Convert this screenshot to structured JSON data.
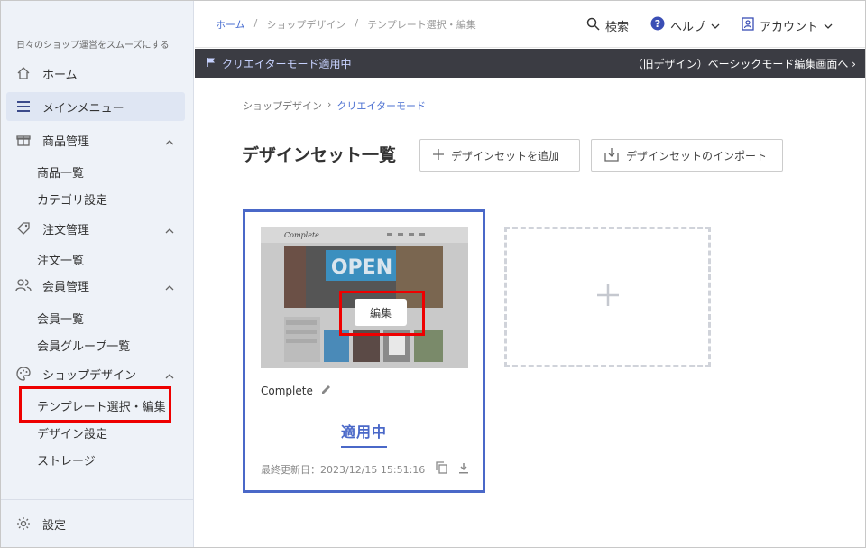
{
  "sidebar": {
    "tagline": "日々のショップ運営をスムーズにする",
    "items": [
      {
        "label": "ホーム"
      },
      {
        "label": "メインメニュー"
      },
      {
        "label": "商品管理"
      },
      {
        "label": "注文管理"
      },
      {
        "label": "会員管理"
      },
      {
        "label": "ショップデザイン"
      }
    ],
    "subs": {
      "product": [
        "商品一覧",
        "カテゴリ設定"
      ],
      "order": [
        "注文一覧"
      ],
      "member": [
        "会員一覧",
        "会員グループ一覧"
      ],
      "design": [
        "テンプレート選択・編集",
        "デザイン設定",
        "ストレージ"
      ]
    },
    "settings": "設定"
  },
  "topbar": {
    "breadcrumb": [
      "ホーム",
      "/",
      "ショップデザイン",
      "/",
      "テンプレート選択・編集"
    ],
    "search": "検索",
    "help": "ヘルプ",
    "account": "アカウント"
  },
  "banner": {
    "left": "クリエイターモード適用中",
    "right": "（旧デザイン）ベーシックモード編集画面へ ›"
  },
  "main": {
    "breadcrumb_parent": "ショップデザイン",
    "breadcrumb_sep": "›",
    "breadcrumb_current": "クリエイターモード",
    "title": "デザインセット一覧",
    "add_button": "デザインセットを追加",
    "import_button": "デザインセットのインポート"
  },
  "card": {
    "name": "Complete",
    "edit_label": "編集",
    "status": "適用中",
    "updated": "最終更新日：2023/12/15 15:51:16",
    "thumb_logo": "Complete",
    "thumb_sign": "OPEN"
  },
  "colors": {
    "accent": "#4a68c8",
    "banner_bg": "#3b3c43",
    "highlight": "#ee0000"
  }
}
